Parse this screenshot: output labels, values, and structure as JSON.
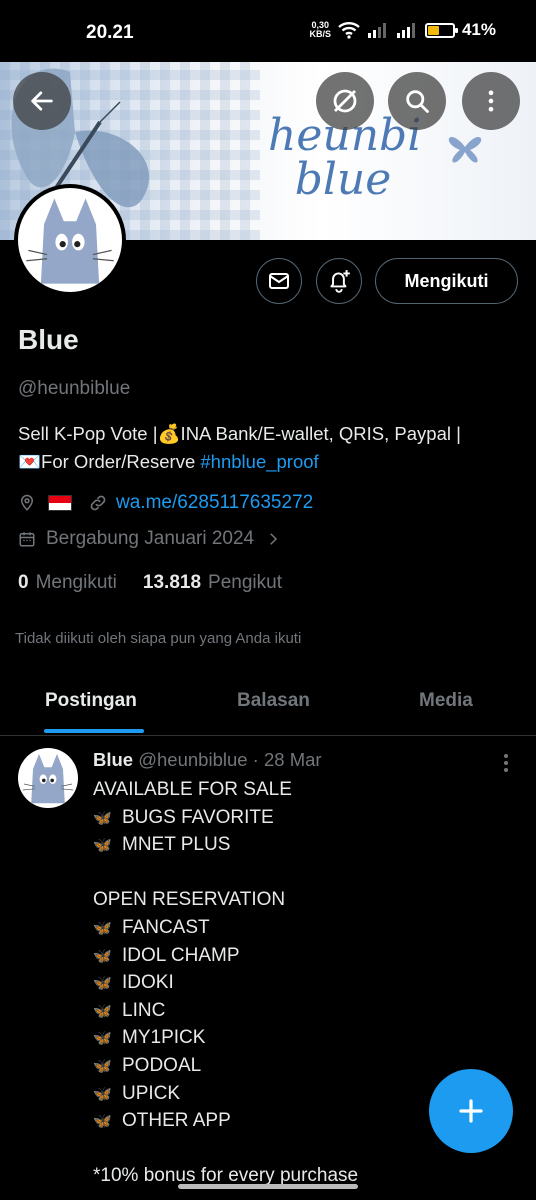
{
  "status_bar": {
    "time": "20.21",
    "net_speed": "0,30",
    "net_unit": "KB/S",
    "battery_level": 0.41,
    "battery_text": "41%"
  },
  "banner": {
    "title_line1": "heunbi",
    "title_line2": "blue"
  },
  "profile": {
    "display_name": "Blue",
    "handle": "@heunbiblue",
    "bio_line1": "Sell K-Pop Vote |💰INA Bank/E-wallet, QRIS, Paypal |",
    "bio_line2": "💌For Order/Reserve ",
    "bio_hashtag": "#hnblue_proof",
    "link": "wa.me/6285117635272",
    "joined": "Bergabung Januari 2024",
    "following_count": "0",
    "following_label": "Mengikuti",
    "followers_count": "13.818",
    "followers_label": "Pengikut",
    "not_followed_note": "Tidak diikuti oleh siapa pun yang Anda ikuti"
  },
  "actions": {
    "follow_label": "Mengikuti"
  },
  "tabs": [
    {
      "label": "Postingan",
      "active": true
    },
    {
      "label": "Balasan",
      "active": false
    },
    {
      "label": "Media",
      "active": false
    }
  ],
  "post": {
    "name": "Blue",
    "handle": "@heunbiblue",
    "sep": " · ",
    "date": "28 Mar",
    "lines": [
      {
        "bullet": false,
        "text": "AVAILABLE FOR SALE"
      },
      {
        "bullet": true,
        "text": "BUGS FAVORITE"
      },
      {
        "bullet": true,
        "text": "MNET PLUS"
      },
      {
        "bullet": false,
        "text": ""
      },
      {
        "bullet": false,
        "text": "OPEN RESERVATION"
      },
      {
        "bullet": true,
        "text": "FANCAST"
      },
      {
        "bullet": true,
        "text": "IDOL CHAMP"
      },
      {
        "bullet": true,
        "text": "IDOKI"
      },
      {
        "bullet": true,
        "text": "LINC"
      },
      {
        "bullet": true,
        "text": "MY1PICK"
      },
      {
        "bullet": true,
        "text": "PODOAL"
      },
      {
        "bullet": true,
        "text": "UPICK"
      },
      {
        "bullet": true,
        "text": "OTHER APP"
      },
      {
        "bullet": false,
        "text": ""
      },
      {
        "bullet": false,
        "text": "*10% bonus for every purchase"
      }
    ]
  },
  "icons": {
    "back": "arrow-left-icon",
    "grok": "grok-icon",
    "search": "search-icon",
    "more": "more-vertical-icon",
    "message": "mail-icon",
    "notify": "bell-plus-icon",
    "location": "location-pin-icon",
    "link": "link-icon",
    "calendar": "calendar-icon",
    "compose": "plus-icon"
  },
  "colors": {
    "accent": "#1d9bf0",
    "muted": "#71767b",
    "text": "#e7e9ea",
    "background": "#000000"
  }
}
